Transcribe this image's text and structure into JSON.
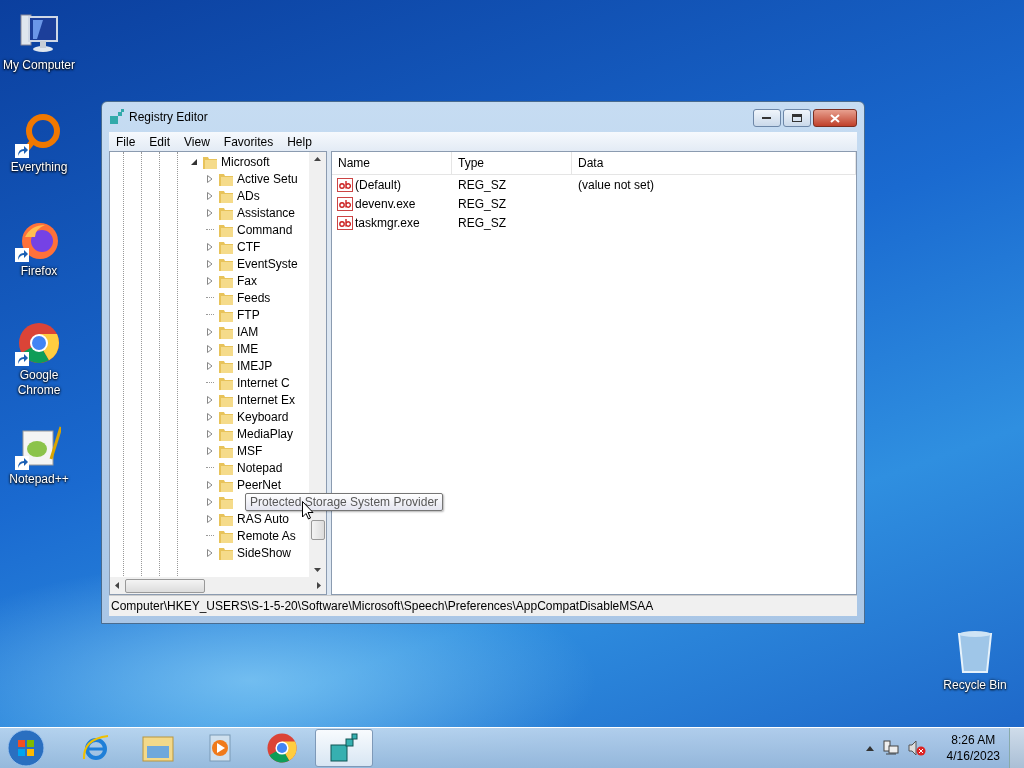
{
  "desktop_icons": [
    {
      "label": "My Computer",
      "kind": "computer",
      "shortcut": false
    },
    {
      "label": "Everything",
      "kind": "everything",
      "shortcut": true
    },
    {
      "label": "Firefox",
      "kind": "firefox",
      "shortcut": true
    },
    {
      "label": "Google Chrome",
      "kind": "chrome",
      "shortcut": true
    },
    {
      "label": "Notepad++",
      "kind": "notepad",
      "shortcut": true
    }
  ],
  "recycle_bin": {
    "label": "Recycle Bin"
  },
  "window": {
    "title": "Registry Editor",
    "menu": [
      "File",
      "Edit",
      "View",
      "Favorites",
      "Help"
    ],
    "tree": {
      "label": "Microsoft",
      "expanded": true,
      "children": [
        {
          "label": "Active Setu",
          "expandable": true
        },
        {
          "label": "ADs",
          "expandable": true
        },
        {
          "label": "Assistance",
          "expandable": true
        },
        {
          "label": "Command",
          "expandable": false
        },
        {
          "label": "CTF",
          "expandable": true
        },
        {
          "label": "EventSyste",
          "expandable": true
        },
        {
          "label": "Fax",
          "expandable": true
        },
        {
          "label": "Feeds",
          "expandable": false
        },
        {
          "label": "FTP",
          "expandable": false
        },
        {
          "label": "IAM",
          "expandable": true
        },
        {
          "label": "IME",
          "expandable": true
        },
        {
          "label": "IMEJP",
          "expandable": true
        },
        {
          "label": "Internet C",
          "expandable": false
        },
        {
          "label": "Internet Ex",
          "expandable": true
        },
        {
          "label": "Keyboard",
          "expandable": true
        },
        {
          "label": "MediaPlay",
          "expandable": true
        },
        {
          "label": "MSF",
          "expandable": true
        },
        {
          "label": "Notepad",
          "expandable": false
        },
        {
          "label": "PeerNet",
          "expandable": true
        },
        {
          "tooltip": "Protected Storage System Provider",
          "expandable": true
        },
        {
          "label": "RAS Auto",
          "expandable": true
        },
        {
          "label": "Remote As",
          "expandable": false
        },
        {
          "label": "SideShow",
          "expandable": true
        }
      ]
    },
    "columns": [
      "Name",
      "Type",
      "Data"
    ],
    "values": [
      {
        "name": "(Default)",
        "type": "REG_SZ",
        "data": "(value not set)"
      },
      {
        "name": "devenv.exe",
        "type": "REG_SZ"
      },
      {
        "name": "taskmgr.exe",
        "type": "REG_SZ"
      }
    ],
    "status_bar": "Computer\\HKEY_USERS\\S-1-5-20\\Software\\Microsoft\\Speech\\Preferences\\AppCompatDisableMSAA"
  },
  "taskbar": {
    "items": [
      {
        "kind": "ie",
        "selected": false
      },
      {
        "kind": "explorer",
        "selected": false
      },
      {
        "kind": "media",
        "selected": false
      },
      {
        "kind": "chrome",
        "selected": false
      },
      {
        "kind": "regedit",
        "selected": true
      }
    ],
    "time": "8:26 AM",
    "date": "4/16/2023"
  }
}
